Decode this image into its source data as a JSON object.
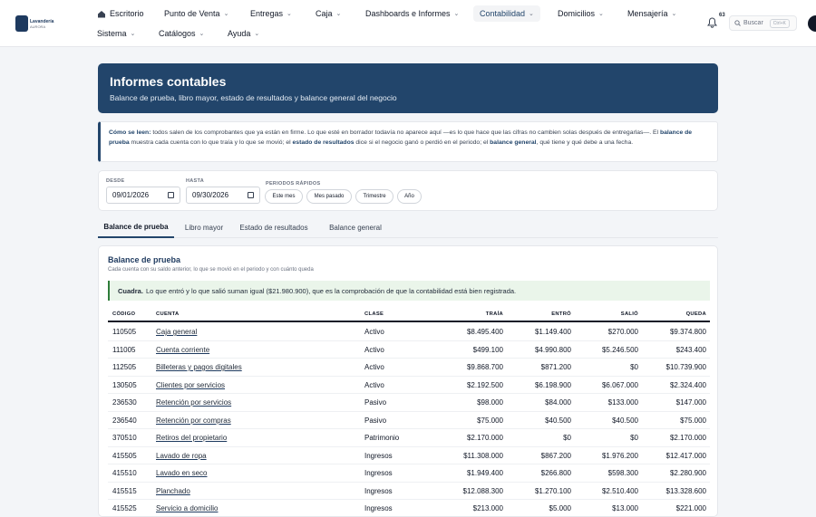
{
  "brand": {
    "name": "Lavandería",
    "sub": "AURORA"
  },
  "nav": {
    "escritorio": "Escritorio",
    "punto_venta": "Punto de Venta",
    "entregas": "Entregas",
    "caja": "Caja",
    "dashboards": "Dashboards e Informes",
    "contabilidad": "Contabilidad",
    "domicilios": "Domicilios",
    "mensajeria": "Mensajería",
    "sistema": "Sistema",
    "catalogos": "Catálogos",
    "ayuda": "Ayuda"
  },
  "notifications": {
    "count": "63"
  },
  "search": {
    "label": "Buscar",
    "shortcut": "Ctrl+K"
  },
  "hero": {
    "title": "Informes contables",
    "subtitle": "Balance de prueba, libro mayor, estado de resultados y balance general del negocio"
  },
  "note": {
    "lead": "Cómo se leen:",
    "t1": " todos salen de los comprobantes que ya están en firme. Lo que esté en borrador todavía no aparece aquí —es lo que hace que las cifras no cambien solas después de entregarlas—. El ",
    "b1": "balance de prueba",
    "t2": " muestra cada cuenta con lo que traía y lo que se movió; el ",
    "b2": "estado de resultados",
    "t3": " dice si el negocio ganó o perdió en el periodo; el ",
    "b3": "balance general",
    "t4": ", qué tiene y qué debe a una fecha."
  },
  "filters": {
    "desde_label": "DESDE",
    "desde": "09/01/2026",
    "hasta_label": "HASTA",
    "hasta": "09/30/2026",
    "quick_label": "PERIODOS RÁPIDOS",
    "quick": [
      "Este mes",
      "Mes pasado",
      "Trimestre",
      "Año"
    ]
  },
  "tabs": [
    "Balance de prueba",
    "Libro mayor",
    "Estado de resultados",
    "Balance general"
  ],
  "active_tab": "Balance de prueba",
  "card": {
    "title": "Balance de prueba",
    "subtitle": "Cada cuenta con su saldo anterior, lo que se movió en el periodo y con cuánto queda",
    "ok_lead": "Cuadra.",
    "ok_text": "Lo que entró y lo que salió suman igual ($21.980.900), que es la comprobación de que la contabilidad está bien registrada."
  },
  "table": {
    "headers": [
      "CÓDIGO",
      "CUENTA",
      "CLASE",
      "TRAÍA",
      "ENTRÓ",
      "SALIÓ",
      "QUEDA"
    ],
    "rows": [
      [
        "110505",
        "Caja general",
        "Activo",
        "$8.495.400",
        "$1.149.400",
        "$270.000",
        "$9.374.800"
      ],
      [
        "111005",
        "Cuenta corriente",
        "Activo",
        "$499.100",
        "$4.990.800",
        "$5.246.500",
        "$243.400"
      ],
      [
        "112505",
        "Billeteras y pagos digitales",
        "Activo",
        "$9.868.700",
        "$871.200",
        "$0",
        "$10.739.900"
      ],
      [
        "130505",
        "Clientes por servicios",
        "Activo",
        "$2.192.500",
        "$6.198.900",
        "$6.067.000",
        "$2.324.400"
      ],
      [
        "236530",
        "Retención por servicios",
        "Pasivo",
        "$98.000",
        "$84.000",
        "$133.000",
        "$147.000"
      ],
      [
        "236540",
        "Retención por compras",
        "Pasivo",
        "$75.000",
        "$40.500",
        "$40.500",
        "$75.000"
      ],
      [
        "370510",
        "Retiros del propietario",
        "Patrimonio",
        "$2.170.000",
        "$0",
        "$0",
        "$2.170.000"
      ],
      [
        "415505",
        "Lavado de ropa",
        "Ingresos",
        "$11.308.000",
        "$867.200",
        "$1.976.200",
        "$12.417.000"
      ],
      [
        "415510",
        "Lavado en seco",
        "Ingresos",
        "$1.949.400",
        "$266.800",
        "$598.300",
        "$2.280.900"
      ],
      [
        "415515",
        "Planchado",
        "Ingresos",
        "$12.088.300",
        "$1.270.100",
        "$2.510.400",
        "$13.328.600"
      ],
      [
        "415525",
        "Servicio a domicilio",
        "Ingresos",
        "$213.000",
        "$5.000",
        "$13.000",
        "$221.000"
      ]
    ]
  },
  "colors": {
    "primary": "#22456b",
    "ok": "#2f7d3a"
  }
}
